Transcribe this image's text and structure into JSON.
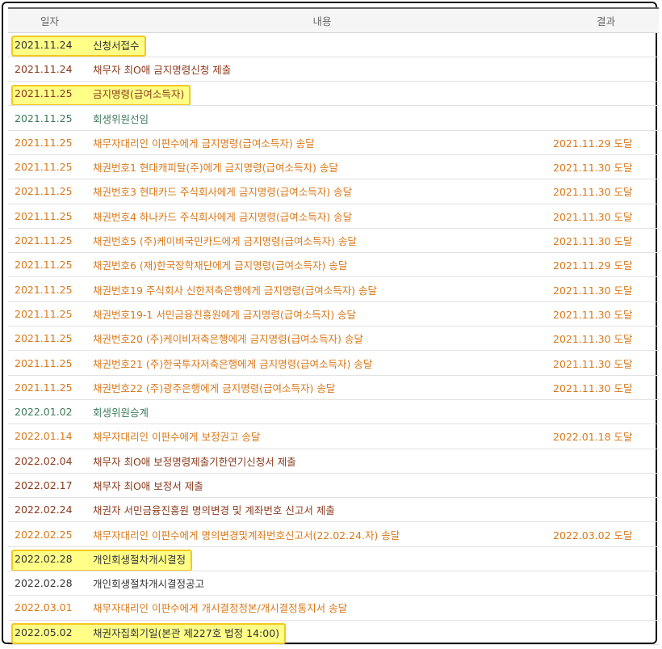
{
  "header": {
    "date": "일자",
    "content": "내용",
    "result": "결과"
  },
  "rows": [
    {
      "date": "2021.11.24",
      "content": "신청서접수",
      "result": "",
      "color": "black",
      "highlight": true
    },
    {
      "date": "2021.11.24",
      "content": "채무자 최O애 금지명령신청 제출",
      "result": "",
      "color": "brown",
      "highlight": false
    },
    {
      "date": "2021.11.25",
      "content": "금지명령(급여소득자)",
      "result": "",
      "color": "brown",
      "highlight": true
    },
    {
      "date": "2021.11.25",
      "content": "회생위원선임",
      "result": "",
      "color": "green",
      "highlight": false
    },
    {
      "date": "2021.11.25",
      "content": "채무자대리인 이판수에게 금지명령(급여소득자) 송달",
      "result": "2021.11.29 도달",
      "color": "orange",
      "highlight": false
    },
    {
      "date": "2021.11.25",
      "content": "채권번호1 현대캐피탈(주)에게 금지명령(급여소득자) 송달",
      "result": "2021.11.30 도달",
      "color": "orange",
      "highlight": false
    },
    {
      "date": "2021.11.25",
      "content": "채권번호3 현대카드 주식회사에게 금지명령(급여소득자) 송달",
      "result": "2021.11.30 도달",
      "color": "orange",
      "highlight": false
    },
    {
      "date": "2021.11.25",
      "content": "채권번호4 하나카드 주식회사에게 금지명령(급여소득자) 송달",
      "result": "2021.11.30 도달",
      "color": "orange",
      "highlight": false
    },
    {
      "date": "2021.11.25",
      "content": "채권번호5 (주)케이비국민카드에게 금지명령(급여소득자) 송달",
      "result": "2021.11.30 도달",
      "color": "orange",
      "highlight": false
    },
    {
      "date": "2021.11.25",
      "content": "채권번호6 (재)한국장학재단에게 금지명령(급여소득자) 송달",
      "result": "2021.11.29 도달",
      "color": "orange",
      "highlight": false
    },
    {
      "date": "2021.11.25",
      "content": "채권번호19 주식회사 신한저축은행에게 금지명령(급여소득자) 송달",
      "result": "2021.11.30 도달",
      "color": "orange",
      "highlight": false
    },
    {
      "date": "2021.11.25",
      "content": "채권번호19-1 서민금융진흥원에게 금지명령(급여소득자) 송달",
      "result": "2021.11.30 도달",
      "color": "orange",
      "highlight": false
    },
    {
      "date": "2021.11.25",
      "content": "채권번호20 (주)케이비저축은행에게 금지명령(급여소득자) 송달",
      "result": "2021.11.30 도달",
      "color": "orange",
      "highlight": false
    },
    {
      "date": "2021.11.25",
      "content": "채권번호21 (주)한국투자저축은행에게 금지명령(급여소득자) 송달",
      "result": "2021.11.30 도달",
      "color": "orange",
      "highlight": false
    },
    {
      "date": "2021.11.25",
      "content": "채권번호22 (주)광주은행에게 금지명령(급여소득자) 송달",
      "result": "2021.11.30 도달",
      "color": "orange",
      "highlight": false
    },
    {
      "date": "2022.01.02",
      "content": "회생위원승계",
      "result": "",
      "color": "green",
      "highlight": false
    },
    {
      "date": "2022.01.14",
      "content": "채무자대리인 이판수에게 보정권고 송달",
      "result": "2022.01.18 도달",
      "color": "orange",
      "highlight": false
    },
    {
      "date": "2022.02.04",
      "content": "채무자 최O애 보정명령제출기한연기신청서 제출",
      "result": "",
      "color": "brown",
      "highlight": false
    },
    {
      "date": "2022.02.17",
      "content": "채무자 최O애 보정서 제출",
      "result": "",
      "color": "brown",
      "highlight": false
    },
    {
      "date": "2022.02.24",
      "content": "채권자 서민금융진흥원 명의변경 및 계좌번호 신고서 제출",
      "result": "",
      "color": "brown",
      "highlight": false
    },
    {
      "date": "2022.02.25",
      "content": "채무자대리인 이판수에게 명의변경및계좌번호신고서(22.02.24.자) 송달",
      "result": "2022.03.02 도달",
      "color": "orange",
      "highlight": false
    },
    {
      "date": "2022.02.28",
      "content": "개인회생절차개시결정",
      "result": "",
      "color": "black",
      "highlight": true
    },
    {
      "date": "2022.02.28",
      "content": "개인회생절차개시결정공고",
      "result": "",
      "color": "black",
      "highlight": false
    },
    {
      "date": "2022.03.01",
      "content": "채무자대리인 이판수에게 개시결정정본/개시결정통지서 송달",
      "result": "",
      "color": "orange",
      "highlight": false
    },
    {
      "date": "2022.05.02",
      "content": "채권자집회기일(본관 제227호 법정 14:00)",
      "result": "",
      "color": "black",
      "highlight": true
    }
  ]
}
